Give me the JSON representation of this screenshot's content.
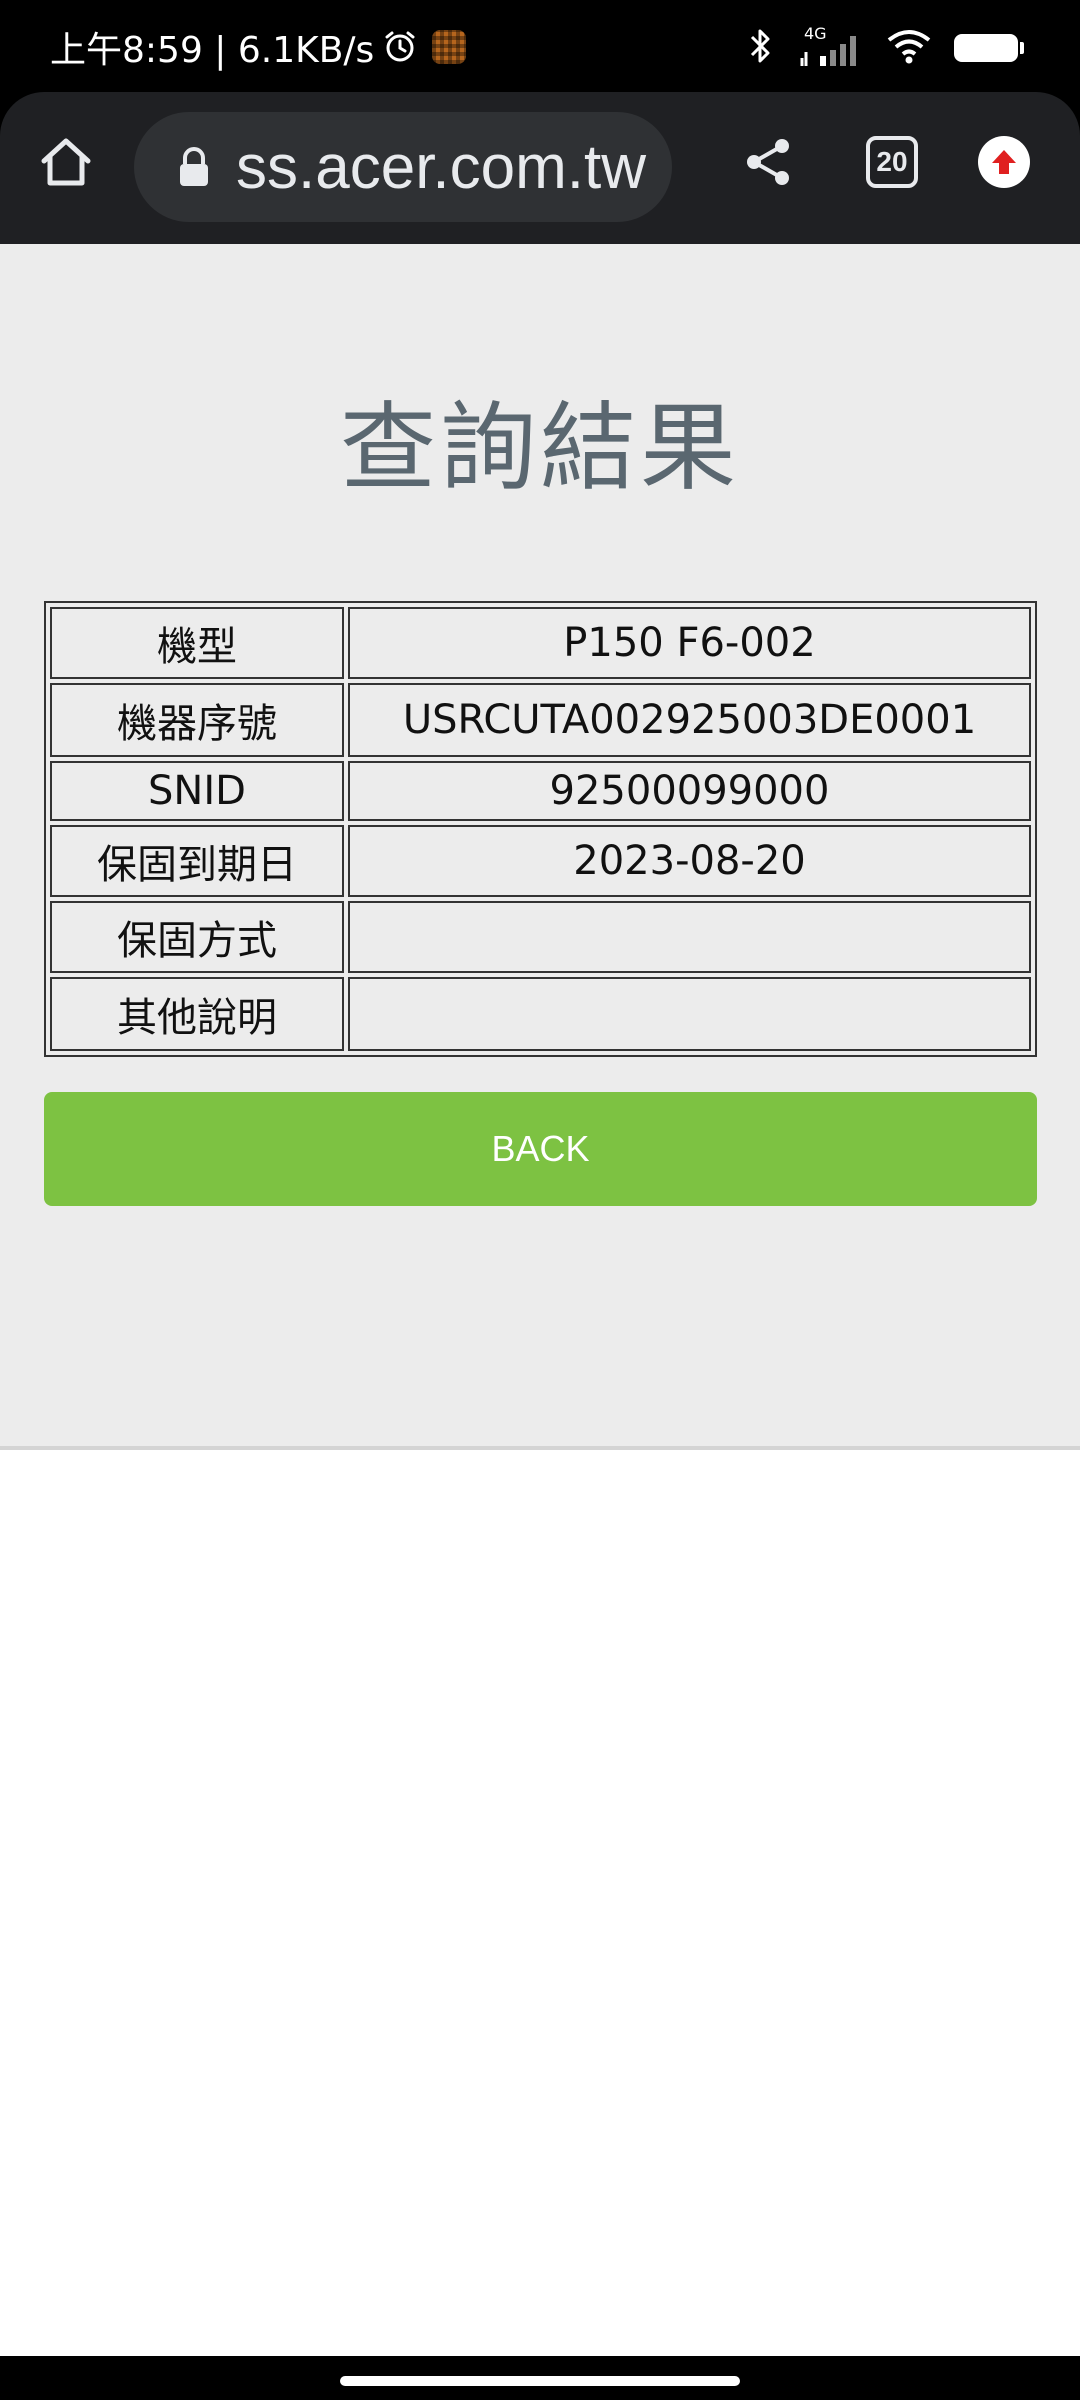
{
  "status_bar": {
    "time_speed": "上午8:59 | 6.1KB/s",
    "network": "4G",
    "battery": "93",
    "icons": [
      "alarm-icon",
      "app-notification-icon",
      "bluetooth-icon",
      "signal-icon",
      "wifi-icon",
      "battery-icon"
    ]
  },
  "browser": {
    "url": "ss.acer.com.tw",
    "tab_count": "20",
    "icons": [
      "home-icon",
      "lock-icon",
      "share-icon",
      "tabs-icon",
      "update-icon"
    ]
  },
  "page": {
    "title": "查詢結果",
    "table": {
      "rows": [
        {
          "label": "機型",
          "value": "P150 F6-002"
        },
        {
          "label": "機器序號",
          "value": "USRCUTA002925003DE0001"
        },
        {
          "label": "SNID",
          "value": "92500099000"
        },
        {
          "label": "保固到期日",
          "value": "2023-08-20"
        },
        {
          "label": "保固方式",
          "value": ""
        },
        {
          "label": "其他說明",
          "value": ""
        }
      ]
    },
    "back_label": "BACK"
  },
  "colors": {
    "page_bg": "#ececec",
    "title": "#5a6770",
    "button": "#7dc242",
    "toolbar": "#1f2023",
    "url_box": "#2f3134"
  }
}
